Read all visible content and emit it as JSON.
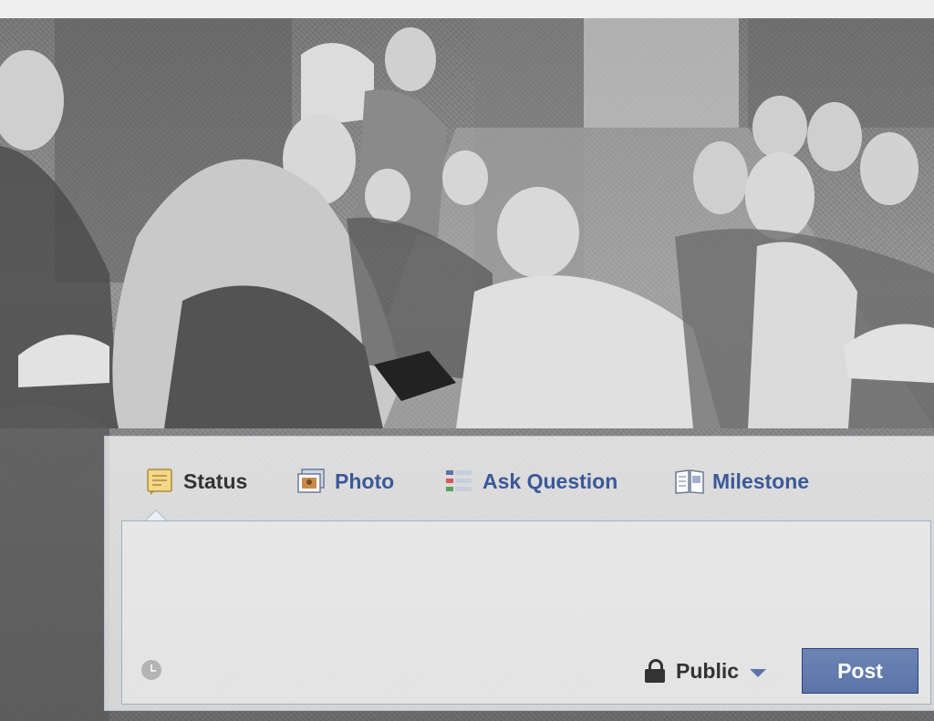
{
  "composer": {
    "tabs": [
      {
        "label": "Status",
        "icon": "status-icon",
        "active": true
      },
      {
        "label": "Photo",
        "icon": "photo-icon",
        "active": false
      },
      {
        "label": "Ask Question",
        "icon": "question-icon",
        "active": false
      },
      {
        "label": "Milestone",
        "icon": "milestone-icon",
        "active": false
      }
    ],
    "text_value": "",
    "audience": {
      "label": "Public",
      "icon": "lock-icon"
    },
    "post_label": "Post"
  },
  "colors": {
    "link": "#3b5998",
    "button": "#5b74a8",
    "text": "#333333"
  }
}
